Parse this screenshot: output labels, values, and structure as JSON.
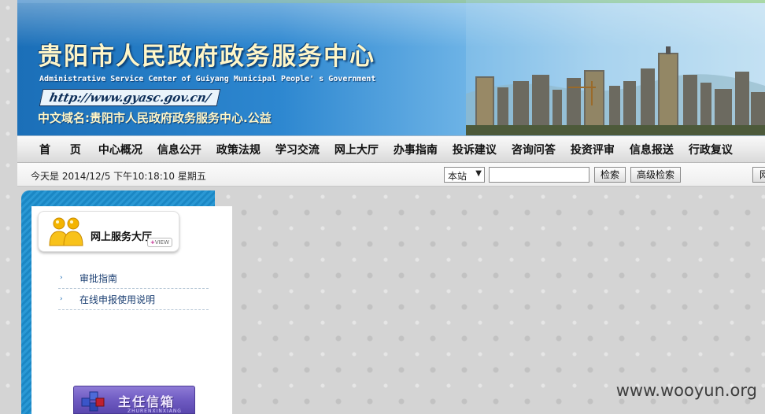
{
  "header": {
    "title": "贵阳市人民政府政务服务中心",
    "subtitle": "Administrative Service Center of Guiyang Municipal People' s Government",
    "url": "http://www.gyasc.gov.cn/",
    "domain": "中文域名:贵阳市人民政府政务服务中心.公益"
  },
  "nav": {
    "items": [
      {
        "label": "首 页"
      },
      {
        "label": "中心概况"
      },
      {
        "label": "信息公开"
      },
      {
        "label": "政策法规"
      },
      {
        "label": "学习交流"
      },
      {
        "label": "网上大厅"
      },
      {
        "label": "办事指南"
      },
      {
        "label": "投诉建议"
      },
      {
        "label": "咨询问答"
      },
      {
        "label": "投资评审"
      },
      {
        "label": "信息报送"
      },
      {
        "label": "行政复议"
      }
    ]
  },
  "infobar": {
    "date_text": "今天是  2014/12/5 下午10:18:10 星期五",
    "scope_value": "本站",
    "search_value": "",
    "search_button": "检索",
    "advanced_button": "高级检索",
    "edge_button": "网"
  },
  "panel": {
    "hall_title": "网上服务大厅",
    "view_tag": "VIEW",
    "links": [
      {
        "label": "审批指南"
      },
      {
        "label": "在线申报使用说明"
      }
    ],
    "mailbox_title": "主任信箱",
    "mailbox_sub": "ZHURENXINXIANG"
  },
  "watermark": "www.wooyun.org",
  "colors": {
    "banner_blue": "#1b6fb8",
    "title_yellow": "#fff6c8",
    "panel_blue": "#1b87c4",
    "link_blue": "#1b3f72",
    "mailbox_purple": "#6f5bc2"
  }
}
